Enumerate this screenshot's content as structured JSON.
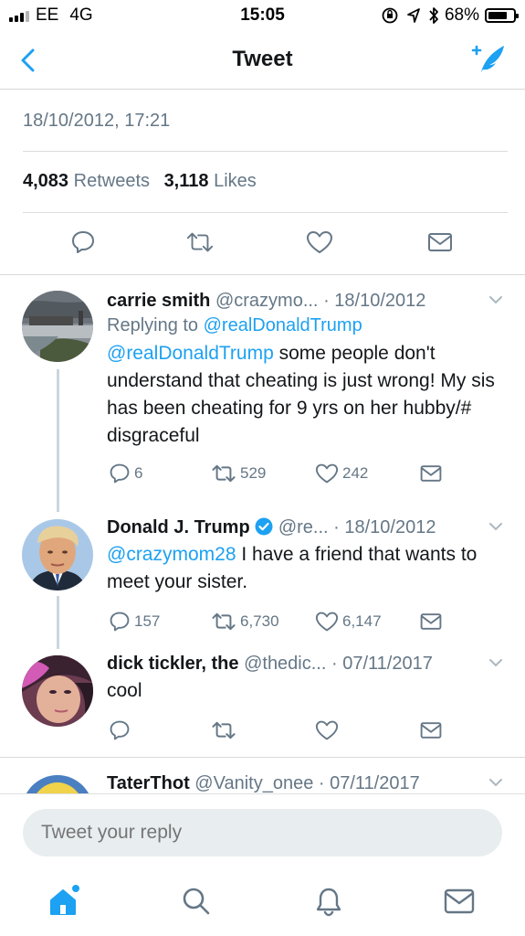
{
  "status_bar": {
    "carrier": "EE",
    "network": "4G",
    "time": "15:05",
    "battery": "68%",
    "battery_level": 0.68,
    "icons": [
      "signal-icon",
      "orientation-lock-icon",
      "location-icon",
      "bluetooth-icon",
      "battery-icon"
    ]
  },
  "nav": {
    "title": "Tweet",
    "back_icon": "chevron-left-icon",
    "compose_icon": "compose-tweet-icon"
  },
  "detail": {
    "date": "18/10/2012, 17:21",
    "retweets_count": "4,083",
    "retweets_label": "Retweets",
    "likes_count": "3,118",
    "likes_label": "Likes"
  },
  "tweets": [
    {
      "name": "carrie smith",
      "handle": "@crazymo...",
      "time": "· 18/10/2012",
      "reply_prefix": "Replying to ",
      "reply_to": "@realDonaldTrump",
      "mention": "@realDonaldTrump",
      "text": " some people don't understand that cheating is just wrong! My sis has been cheating for 9 yrs on her hubby/# disgraceful",
      "replies": "6",
      "retweets": "529",
      "likes": "242"
    },
    {
      "name": "Donald J. Trump",
      "handle": "@re...",
      "time": "· 18/10/2012",
      "mention": "@crazymom28",
      "text": " I have a friend that wants to meet your sister.",
      "replies": "157",
      "retweets": "6,730",
      "likes": "6,147",
      "verified": true
    },
    {
      "name": "dick tickler, the",
      "handle": "@thedic...",
      "time": "· 07/11/2017",
      "text": "cool"
    },
    {
      "name": "TaterThot",
      "handle": "@Vanity_onee",
      "time": "· 07/11/2017"
    }
  ],
  "reply_box": {
    "placeholder": "Tweet your reply"
  },
  "tab_bar": [
    "home-icon",
    "search-icon",
    "notifications-icon",
    "messages-icon"
  ],
  "colors": {
    "accent": "#1da1f2",
    "secondary_text": "#657786",
    "divider": "#e1e8ed",
    "reply_box_bg": "#e8edf0"
  }
}
